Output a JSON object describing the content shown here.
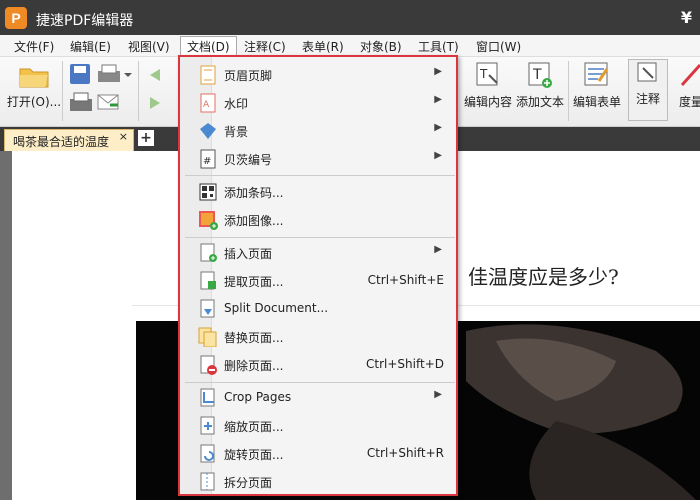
{
  "title_bar": {
    "app_name": "捷速PDF编辑器",
    "logo_letter": "P",
    "corner_symbol": "¥"
  },
  "menu_bar": {
    "items": [
      "文件(F)",
      "编辑(E)",
      "视图(V)",
      "文档(D)",
      "注释(C)",
      "表单(R)",
      "对象(B)",
      "工具(T)",
      "窗口(W)"
    ],
    "active": "文档(D)"
  },
  "toolbar": {
    "open_label": "打开(O)...",
    "edit_content_label": "编辑内容",
    "add_text_label": "添加文本",
    "edit_form_label": "编辑表单",
    "annotate_label": "注释",
    "measure_label": "度量"
  },
  "tabs": {
    "doc_tab_label": "喝茶最合适的温度",
    "close_symbol": "×",
    "new_tab_symbol": "+"
  },
  "document": {
    "heading_fragment": "佳温度应是多少?"
  },
  "document_menu": {
    "items": [
      {
        "label": "页眉页脚",
        "submenu": true
      },
      {
        "label": "水印",
        "submenu": true
      },
      {
        "label": "背景",
        "submenu": true
      },
      {
        "label": "贝茨编号",
        "submenu": true
      },
      {
        "label": "添加条码..."
      },
      {
        "label": "添加图像..."
      },
      {
        "label": "插入页面",
        "submenu": true
      },
      {
        "label": "提取页面...",
        "shortcut": "Ctrl+Shift+E"
      },
      {
        "label": "Split Document..."
      },
      {
        "label": "替换页面..."
      },
      {
        "label": "删除页面...",
        "shortcut": "Ctrl+Shift+D"
      },
      {
        "label": "Crop Pages",
        "submenu": true
      },
      {
        "label": "缩放页面..."
      },
      {
        "label": "旋转页面...",
        "shortcut": "Ctrl+Shift+R"
      },
      {
        "label": "拆分页面"
      }
    ]
  },
  "colors": {
    "highlight_border": "#d9363e",
    "tab_active": "#fdeec7",
    "titlebar": "#3a3a3a"
  }
}
